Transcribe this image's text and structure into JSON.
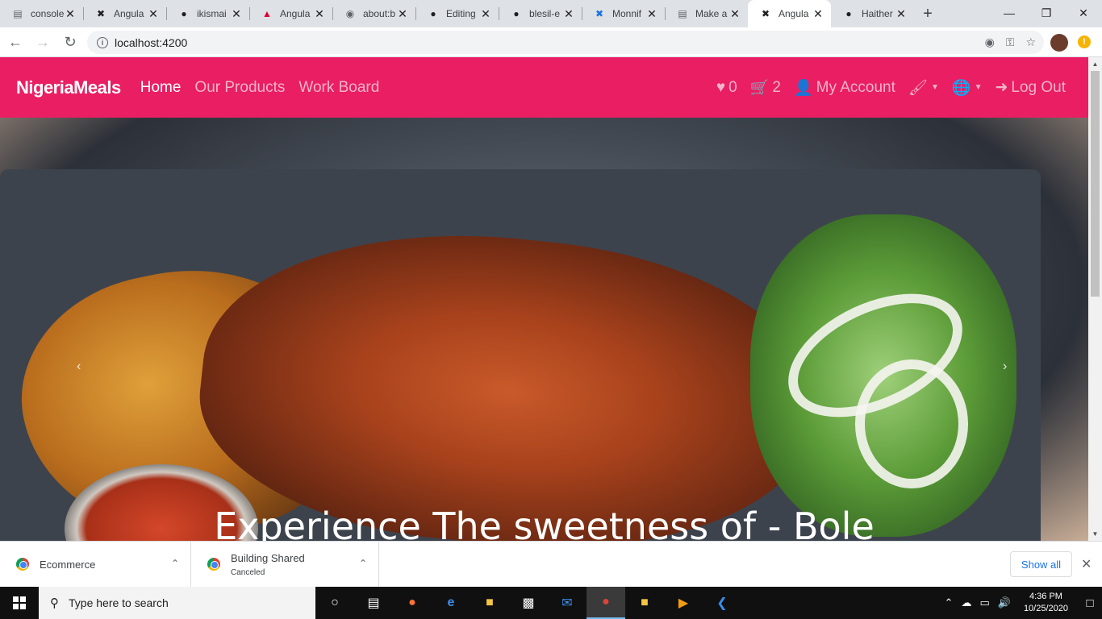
{
  "browser": {
    "tabs": [
      {
        "title": "console",
        "icon": "document-icon",
        "color": "#5f6368"
      },
      {
        "title": "Angula",
        "icon": "angular-x-icon",
        "color": "#202124"
      },
      {
        "title": "ikismai",
        "icon": "github-icon",
        "color": "#202124"
      },
      {
        "title": "Angula",
        "icon": "angular-shield-icon",
        "color": "#dd0031"
      },
      {
        "title": "about:b",
        "icon": "globe-icon",
        "color": "#5f6368"
      },
      {
        "title": "Editing",
        "icon": "github-icon",
        "color": "#202124"
      },
      {
        "title": "blesil-e",
        "icon": "github-icon",
        "color": "#202124"
      },
      {
        "title": "Monnif",
        "icon": "monnify-icon",
        "color": "#1a73e8"
      },
      {
        "title": "Make a",
        "icon": "document-icon",
        "color": "#5f6368"
      },
      {
        "title": "Angula",
        "icon": "angular-x-icon",
        "color": "#202124",
        "active": true
      },
      {
        "title": "Haither",
        "icon": "github-icon",
        "color": "#202124"
      }
    ],
    "url": "localhost:4200"
  },
  "navbar": {
    "brand": "NigeriaMeals",
    "links": [
      "Home",
      "Our Products",
      "Work Board"
    ],
    "favorites_count": "0",
    "cart_count": "2",
    "account": "My Account",
    "logout": "Log Out",
    "bg_color": "#e91e63"
  },
  "hero": {
    "caption": "Experience The sweetness of - Bole"
  },
  "downloads": {
    "items": [
      {
        "name": "Ecommerce",
        "status": ""
      },
      {
        "name": "Building Shared",
        "status": "Canceled"
      }
    ],
    "show_all": "Show all"
  },
  "taskbar": {
    "search_placeholder": "Type here to search",
    "time": "4:36 PM",
    "date": "10/25/2020"
  }
}
